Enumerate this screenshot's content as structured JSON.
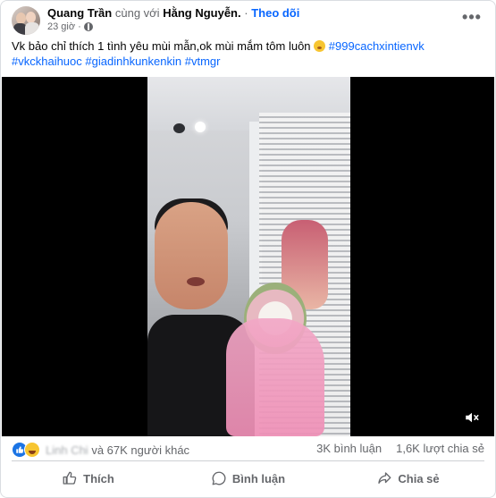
{
  "post": {
    "author": "Quang Trần",
    "with_text": "cùng với",
    "tagged": "Hằng Nguyễn.",
    "separator": "·",
    "follow": "Theo dõi",
    "time": "23 giờ",
    "more_icon": "more-horizontal-icon",
    "caption_text": "Vk bảo chỉ thích 1 tình yêu mùi mẫn,ok mùi mắm tôm luôn",
    "hashtags": [
      "#999cachxintienvk",
      "#vkckhaihuoc",
      "#giadinhkunkenkin",
      "#vtmgr"
    ]
  },
  "video": {
    "mute_icon": "speaker-muted-icon"
  },
  "stats": {
    "reactors_blurred": "Linh Chi",
    "reactions_suffix": "và 67K người khác",
    "comments": "3K bình luận",
    "shares": "1,6K lượt chia sẻ"
  },
  "actions": {
    "like": "Thích",
    "comment": "Bình luận",
    "share": "Chia sẻ"
  },
  "colors": {
    "link": "#0866ff",
    "secondary_text": "#65676b",
    "like_blue": "#1b74e4"
  }
}
